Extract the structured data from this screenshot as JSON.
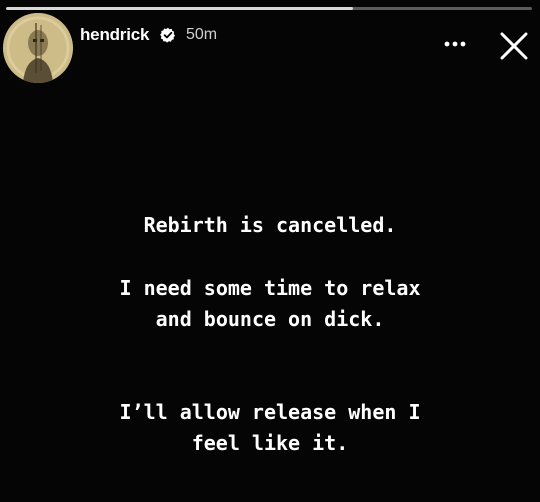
{
  "story": {
    "progress_fraction": 0.66,
    "colors": {
      "background": "#050505",
      "text": "#ffffff",
      "progress_fill": "#d9d9d9"
    }
  },
  "header": {
    "username": "hendrick",
    "timestamp": "50m",
    "verified_icon": "verified-badge-icon",
    "more_icon": "more-dots-icon",
    "close_icon": "close-icon"
  },
  "content": {
    "paragraph_1": "Rebirth is cancelled.",
    "paragraph_2": "I need some time to relax\nand bounce on dick.",
    "paragraph_3": "I’ll allow release when I\nfeel like it."
  }
}
